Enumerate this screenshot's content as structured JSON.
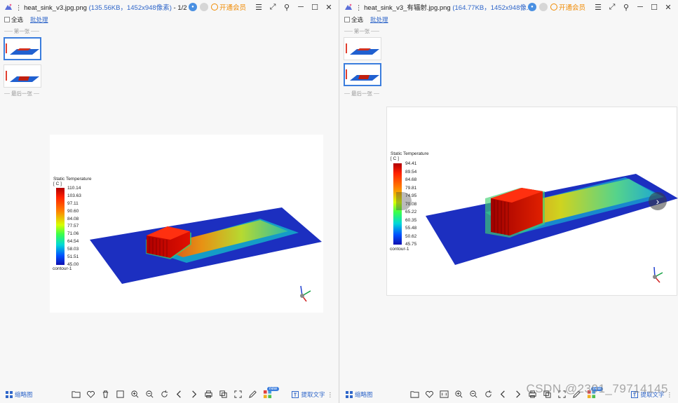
{
  "left": {
    "title_prefix": "heat_sink_v3.jpg.png",
    "meta": "(135.56KB，1452x948像素)",
    "counter": " - 1/2",
    "vip_label": "开通会员",
    "select_all": "全选",
    "batch": "批处理",
    "first_label": "第一张",
    "last_label": "最后一张",
    "thumb_label": "缩略图",
    "extract_text": "提取文字",
    "new_badge": "new",
    "legend": {
      "title_line1": "Static Temperature",
      "title_line2": "[ C ]",
      "ticks": [
        "110.14",
        "103.63",
        "97.11",
        "90.60",
        "84.08",
        "77.57",
        "71.06",
        "64.54",
        "58.03",
        "51.51",
        "45.00"
      ],
      "footer": "contour-1"
    }
  },
  "right": {
    "title_prefix": "heat_sink_v3_有辐射.jpg.png",
    "meta": "(164.77KB，1452x948像...",
    "vip_label": "开通会员",
    "select_all": "全选",
    "batch": "批处理",
    "first_label": "第一张",
    "last_label": "最后一张",
    "thumb_label": "缩略图",
    "extract_text": "提取文字",
    "new_badge": "new",
    "legend": {
      "title_line1": "Static Temperature",
      "title_line2": "[ C ]",
      "ticks": [
        "94.41",
        "89.54",
        "84.68",
        "79.81",
        "74.95",
        "70.08",
        "65.22",
        "60.35",
        "55.48",
        "50.62",
        "45.75"
      ],
      "footer": "contour-1"
    }
  },
  "icons": {
    "menu": "☰",
    "minimize": "─",
    "maximize": "☐",
    "close": "✕",
    "pin": "⚲",
    "fullscreen": "⤢",
    "next": "›"
  },
  "watermark": "CSDN @2301_79714145"
}
